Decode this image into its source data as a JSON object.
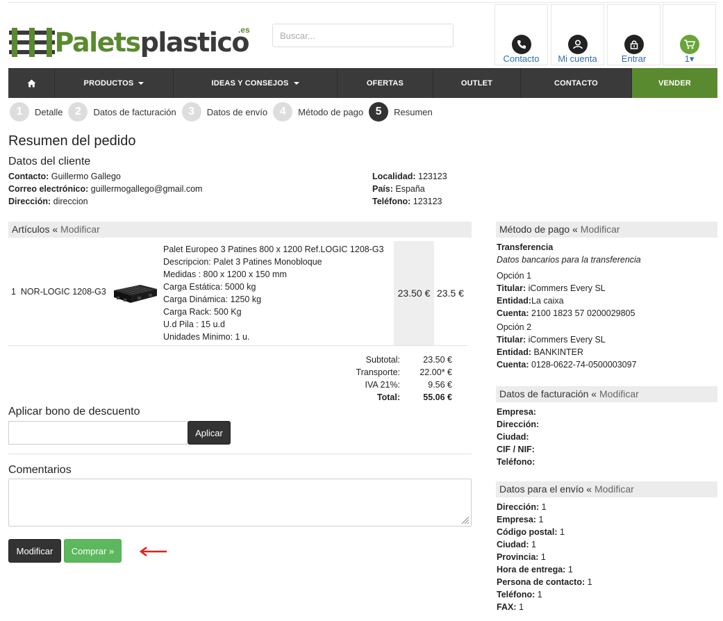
{
  "header": {
    "logo": {
      "part1": "Palets",
      "part2": "plastico",
      "tld": ".es"
    },
    "search_placeholder": "Buscar...",
    "boxes": [
      {
        "label": "Contacto",
        "icon": "phone-icon"
      },
      {
        "label": "Mi cuenta",
        "icon": "user-icon"
      },
      {
        "label": "Entrar",
        "icon": "lock-icon"
      },
      {
        "label": "1▾",
        "icon": "cart-icon"
      }
    ]
  },
  "nav": {
    "items": [
      "PRODUCTOS",
      "IDEAS Y CONSEJOS",
      "OFERTAS",
      "OUTLET",
      "CONTACTO",
      "VENDER"
    ],
    "home_icon": "home-icon"
  },
  "steps": [
    {
      "num": "1",
      "label": "Detalle"
    },
    {
      "num": "2",
      "label": "Datos de facturación"
    },
    {
      "num": "3",
      "label": "Datos de envío"
    },
    {
      "num": "4",
      "label": "Método de pago"
    },
    {
      "num": "5",
      "label": "Resumen"
    }
  ],
  "page_title": "Resumen del pedido",
  "client": {
    "title": "Datos del cliente",
    "left": [
      {
        "k": "Contacto:",
        "v": " Guillermo Gallego"
      },
      {
        "k": "Correo electrónico:",
        "v": " guillermogallego@gmail.com"
      },
      {
        "k": "Dirección:",
        "v": " direccion"
      }
    ],
    "right": [
      {
        "k": "Localidad:",
        "v": " 123123"
      },
      {
        "k": "País:",
        "v": " España"
      },
      {
        "k": "Teléfono:",
        "v": " 123123"
      }
    ]
  },
  "articles": {
    "header": "Artículos",
    "sep": " « ",
    "modify": "Modificar",
    "qty": "1",
    "ref": "NOR-LOGIC 1208-G3",
    "desc": [
      "Palet Europeo 3 Patines 800 x 1200 Ref.LOGIC 1208-G3",
      "Descripcion: Palet 3 Patines Monobloque",
      "Medidas : 800 x 1200 x 150 mm",
      "Carga Estática: 5000 kg",
      "Carga Dinámica: 1250 kg",
      "Carga Rack: 500 Kg",
      "U.d Pila : 15 u.d",
      "Unidades Minimo: 1 u."
    ],
    "unit_price": "23.50 €",
    "total_price": "23.5 €"
  },
  "totals": [
    {
      "k": "Subtotal:",
      "v": "23.50 €",
      "bold": false
    },
    {
      "k": "Transporte:",
      "v": "22.00* €",
      "bold": false
    },
    {
      "k": "IVA 21%:",
      "v": "9.56 €",
      "bold": false
    },
    {
      "k": "Total:",
      "v": "55.06 €",
      "bold": true
    }
  ],
  "coupon": {
    "label": "Aplicar bono de descuento",
    "button": "Aplicar",
    "value": ""
  },
  "comments": {
    "label": "Comentarios",
    "value": ""
  },
  "actions": {
    "modify": "Modificar",
    "buy": "Comprar »"
  },
  "payment": {
    "header": "Método de pago",
    "sep": " « ",
    "modify": "Modificar",
    "method": "Transferencia",
    "note": "Datos bancarios para la transferencia",
    "options": [
      {
        "title": "Opción 1",
        "rows": [
          {
            "k": "Titular:",
            "v": " iCommers Every SL"
          },
          {
            "k": "Entidad:",
            "v": "La caixa"
          },
          {
            "k": "Cuenta:",
            "v": " 2100 1823 57 0200029805"
          }
        ]
      },
      {
        "title": "Opción 2",
        "rows": [
          {
            "k": "Titular:",
            "v": " iCommers Every SL"
          },
          {
            "k": "Entidad:",
            "v": " BANKINTER"
          },
          {
            "k": "Cuenta:",
            "v": " 0128-0622-74-0500003097"
          }
        ]
      }
    ]
  },
  "billing": {
    "header": "Datos de facturación",
    "sep": " « ",
    "modify": "Modificar",
    "rows": [
      {
        "k": "Empresa:",
        "v": ""
      },
      {
        "k": "Dirección:",
        "v": ""
      },
      {
        "k": "Ciudad:",
        "v": ""
      },
      {
        "k": "CIF / NIF:",
        "v": ""
      },
      {
        "k": "Teléfono:",
        "v": ""
      }
    ]
  },
  "shipping": {
    "header": "Datos para el envío",
    "sep": " « ",
    "modify": "Modificar",
    "rows": [
      {
        "k": "Dirección:",
        "v": " 1"
      },
      {
        "k": "Empresa:",
        "v": " 1"
      },
      {
        "k": "Código postal:",
        "v": " 1"
      },
      {
        "k": "Ciudad:",
        "v": " 1"
      },
      {
        "k": "Provincia:",
        "v": " 1"
      },
      {
        "k": "Hora de entrega:",
        "v": " 1"
      },
      {
        "k": "Persona de contacto:",
        "v": " 1"
      },
      {
        "k": "Teléfono:",
        "v": " 1"
      },
      {
        "k": "FAX:",
        "v": " 1"
      }
    ]
  },
  "colors": {
    "brand_green": "#5a8a2f",
    "nav_dark": "#3a3a3a",
    "buy_green": "#5cb85c",
    "link_blue": "#2b6fb2"
  }
}
